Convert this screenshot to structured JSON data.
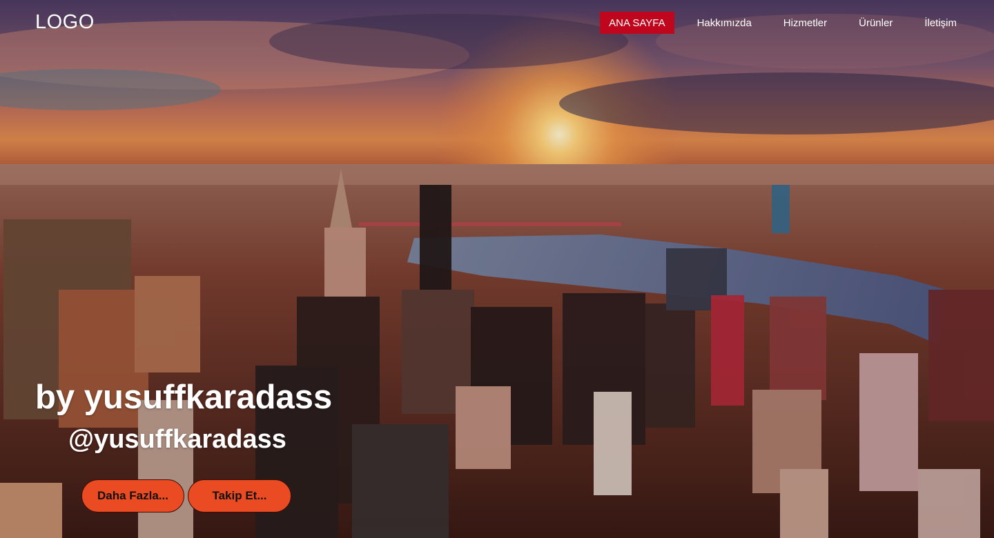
{
  "header": {
    "logo": "LOGO",
    "nav": [
      {
        "label": "ANA SAYFA",
        "active": true
      },
      {
        "label": "Hakkımızda",
        "active": false
      },
      {
        "label": "Hizmetler",
        "active": false
      },
      {
        "label": "Ürünler",
        "active": false
      },
      {
        "label": "İletişim",
        "active": false
      }
    ]
  },
  "hero": {
    "title": "by yusuffkaradass",
    "handle": "@yusuffkaradass",
    "buttons": {
      "more": "Daha Fazla...",
      "follow": "Takip Et..."
    }
  },
  "colors": {
    "active_nav": "#c0061c",
    "button": "#ea4b23",
    "text": "#ffffff"
  }
}
